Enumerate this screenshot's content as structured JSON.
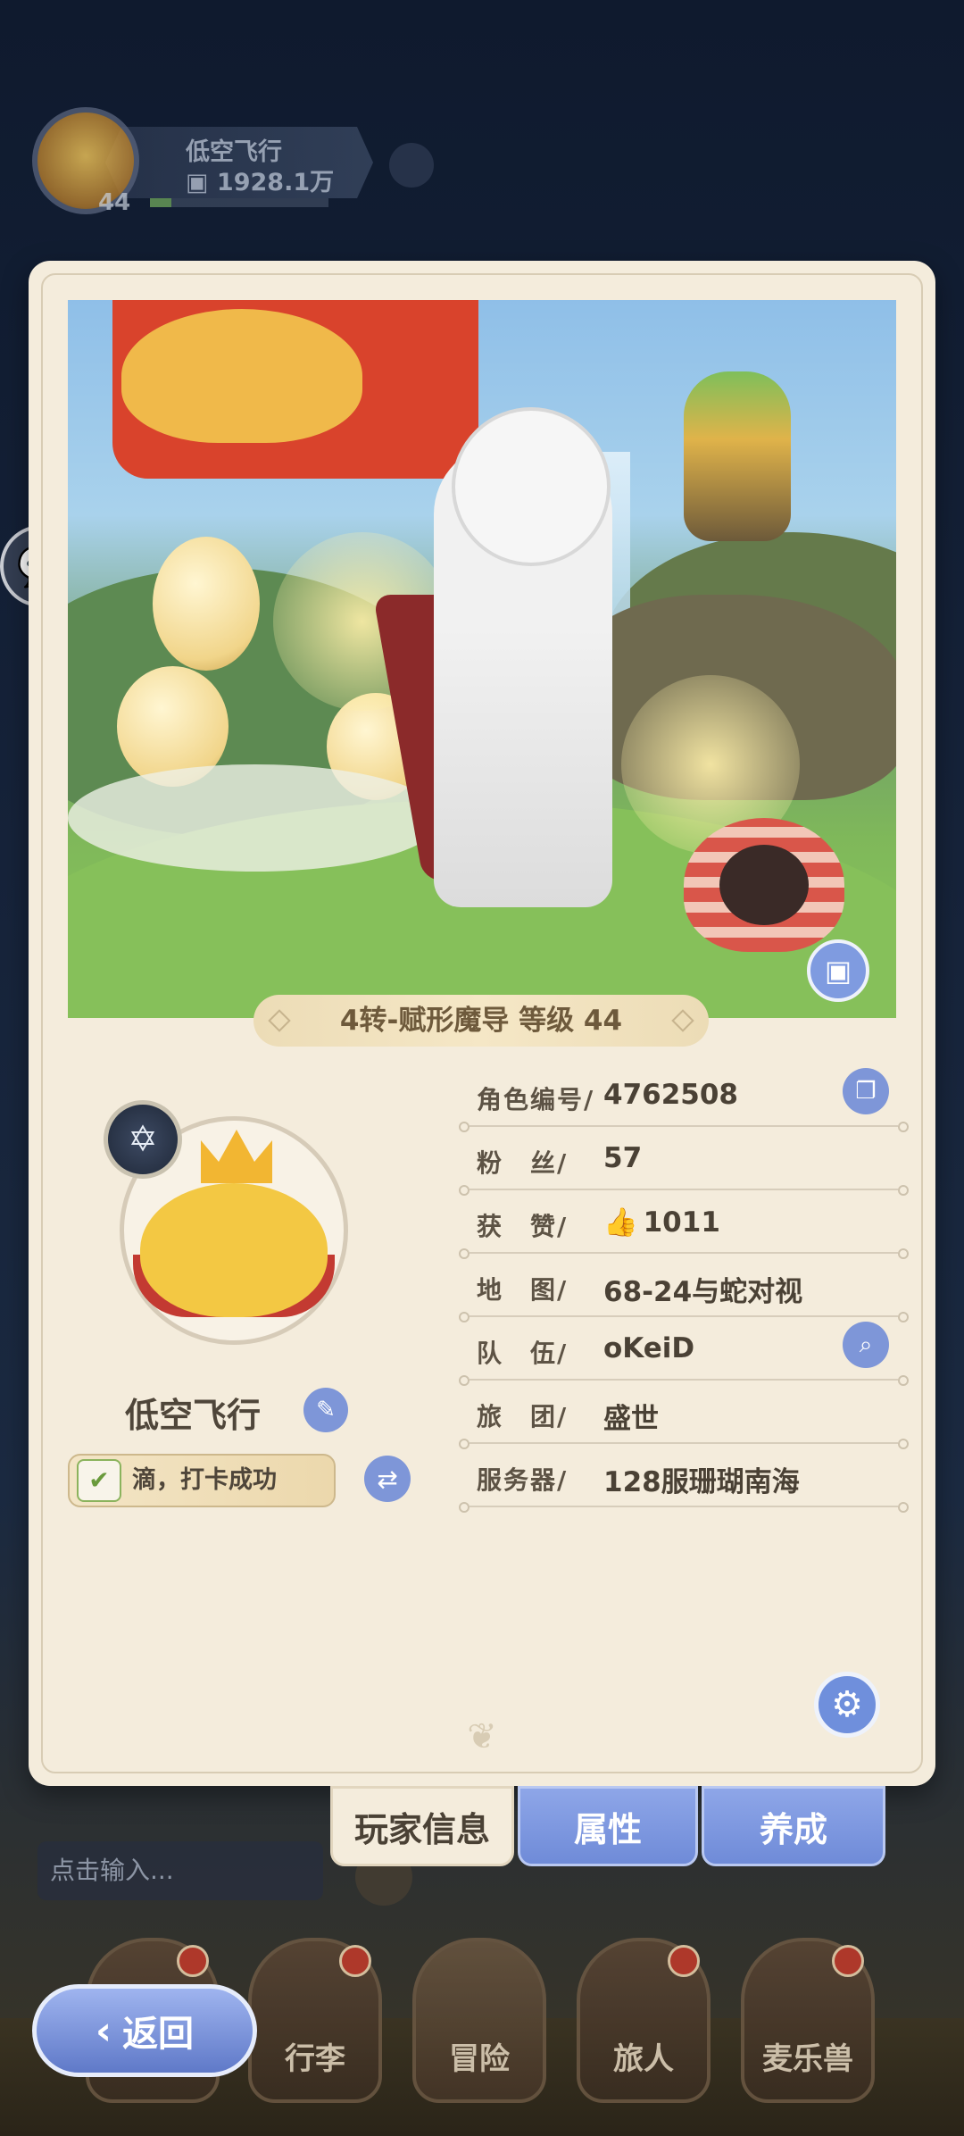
{
  "hud": {
    "player_name": "低空飞行",
    "power": "1928.1万",
    "level": "44",
    "exp_fraction": 0.12
  },
  "panel": {
    "class_banner": "4转-赋形魔导 等级 44",
    "player_name": "低空飞行",
    "checkin_text": "滴，打卡成功",
    "info": [
      {
        "label": "角色编号/",
        "value": "4762508"
      },
      {
        "label": "粉　丝/",
        "value": "57"
      },
      {
        "label": "获　赞/",
        "value": "1011"
      },
      {
        "label": "地　图/",
        "value": "68-24与蛇对视"
      },
      {
        "label": "队　伍/",
        "value": "oKeiD"
      },
      {
        "label": "旅　团/",
        "value": "盛世"
      },
      {
        "label": "服务器/",
        "value": "128服珊瑚南海"
      }
    ]
  },
  "tabs": [
    "玩家信息",
    "属性",
    "养成"
  ],
  "chat_input_placeholder": "点击输入...",
  "bottom_nav": [
    "行李",
    "冒险",
    "旅人",
    "麦乐兽"
  ],
  "back_label": "返回",
  "colors": {
    "accent_blue": "#7e96d8",
    "panel_bg": "#f4ecdc",
    "text_brown": "#4a4135"
  }
}
